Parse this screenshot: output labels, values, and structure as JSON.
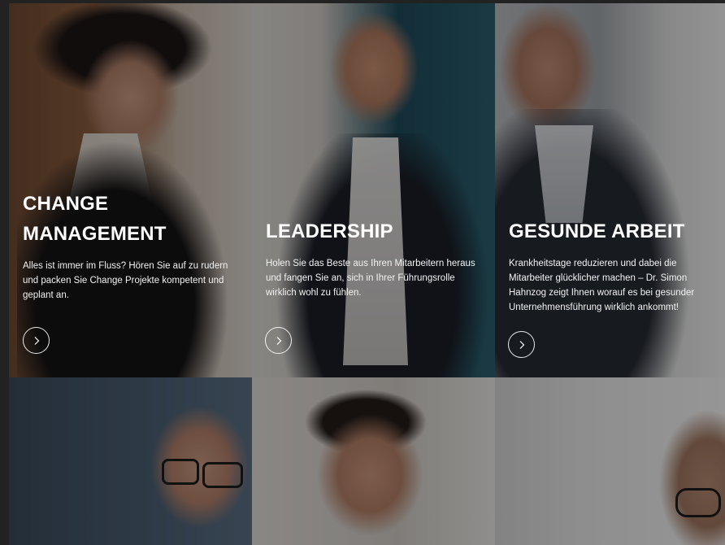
{
  "tiles": [
    {
      "title_line1": "CHANGE",
      "title_line2": "MANAGEMENT",
      "text": "Alles ist immer im Fluss? Hören Sie auf zu rudern und packen Sie Change Projekte kompetent und geplant an.",
      "button_icon": "chevron-right-icon"
    },
    {
      "title_line1": "LEADERSHIP",
      "title_line2": "",
      "text": "Holen Sie das Beste aus Ihren Mitarbeitern heraus und fangen Sie an, sich in Ihrer Führungsrolle wirklich wohl zu fühlen.",
      "button_icon": "chevron-right-icon"
    },
    {
      "title_line1": "GESUNDE ARBEIT",
      "title_line2": "",
      "text": "Krankheitstage reduzieren und dabei die Mitarbeiter glücklicher machen – Dr. Simon Hahnzog zeigt Ihnen worauf es bei gesunder Unternehmensführung wirklich ankommt!",
      "button_icon": "chevron-right-icon"
    }
  ],
  "colors": {
    "text": "#ffffff",
    "overlay": "rgba(0,0,0,0.38)"
  }
}
